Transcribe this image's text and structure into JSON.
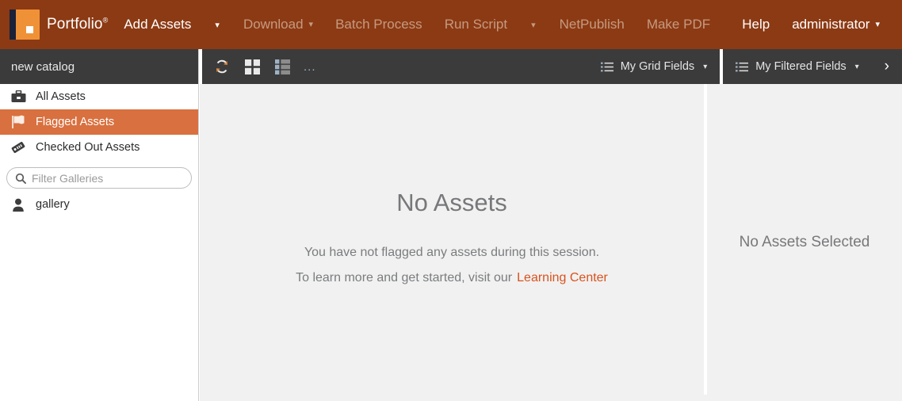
{
  "topbar": {
    "brand": "Portfolio",
    "brand_sup": "®",
    "logo_icon": "portfolio-book-logo",
    "menu": [
      {
        "label": "Add Assets",
        "state": "enabled",
        "has_caret": true,
        "caret_separate": true
      },
      {
        "label": "Download",
        "state": "disabled",
        "has_caret": true,
        "caret_separate": false
      },
      {
        "label": "Batch Process",
        "state": "disabled",
        "has_caret": false,
        "caret_separate": false
      },
      {
        "label": "Run Script",
        "state": "disabled",
        "has_caret": true,
        "caret_separate": true
      },
      {
        "label": "NetPublish",
        "state": "disabled",
        "has_caret": false,
        "caret_separate": false
      },
      {
        "label": "Make PDF",
        "state": "disabled",
        "has_caret": false,
        "caret_separate": false
      }
    ],
    "help_label": "Help",
    "user_label": "administrator",
    "user_caret": "▾",
    "caret_glyph": "▾"
  },
  "sidebar": {
    "catalog_name": "new catalog",
    "items": [
      {
        "label": "All Assets",
        "icon": "briefcase-icon",
        "active": false
      },
      {
        "label": "Flagged Assets",
        "icon": "flag-icon",
        "active": true
      },
      {
        "label": "Checked Out Assets",
        "icon": "tag-icon",
        "active": false
      }
    ],
    "filter": {
      "icon": "search-icon",
      "placeholder": "Filter Galleries",
      "value": ""
    },
    "galleries": [
      {
        "label": "gallery",
        "icon": "person-icon"
      }
    ]
  },
  "toolbar": {
    "refresh_icon": "refresh-icon",
    "grid_view_icon": "grid-view-icon",
    "list_view_icon": "list-view-icon",
    "more_label": "...",
    "grid_fields_label": "My Grid Fields",
    "filtered_fields_label": "My Filtered Fields",
    "fields_icon": "list-fields-icon",
    "caret_glyph": "▾",
    "expand_chevron": "›"
  },
  "main": {
    "empty_title": "No Assets",
    "empty_line1": "You have not flagged any assets during this session.",
    "empty_line2_prefix": "To learn more and get started, visit our",
    "empty_link": "Learning Center"
  },
  "right_panel": {
    "empty_label": "No Assets Selected"
  },
  "colors": {
    "brand_bar": "#8c3a14",
    "accent_orange": "#d9703f",
    "link_orange": "#d9521e",
    "panel_bg": "#f1f1f1",
    "toolbar_bg": "#3b3b3b"
  }
}
